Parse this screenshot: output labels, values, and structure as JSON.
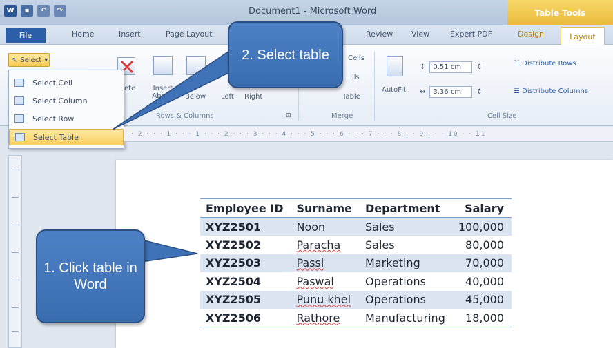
{
  "window": {
    "title": "Document1 - Microsoft Word",
    "contextual_tab_group": "Table Tools"
  },
  "tabs": [
    "File",
    "Home",
    "Insert",
    "Page Layout",
    "Review",
    "View",
    "Expert PDF",
    "Design",
    "Layout"
  ],
  "ribbon": {
    "select_label": "Select",
    "delete_label": "ete",
    "insert_above": "Insert Above",
    "insert_below": "Below",
    "insert_left": "Left",
    "insert_right": "Right",
    "rows_columns_group": "Rows & Columns",
    "merge_cells_top": "Cells",
    "merge_split_cells": "lls",
    "merge_split_table": "Table",
    "merge_group": "Merge",
    "autofit_label": "AutoFit",
    "row_height": "0.51 cm",
    "col_width": "3.36 cm",
    "distribute_rows": "Distribute Rows",
    "distribute_columns": "Distribute Columns",
    "cell_size_group": "Cell Size"
  },
  "select_menu": {
    "items": [
      "Select Cell",
      "Select Column",
      "Select Row",
      "Select Table"
    ],
    "active_index": 3
  },
  "ruler_text": "· 2 · · · 1 · · · 1 · · · 2 · · · 3 · · · 4 · · · 5 · · · 6 · · · 7 · · · 8 · · 9 · · · 10 · · 11",
  "table": {
    "headers": [
      "Employee ID",
      "Surname",
      "Department",
      "Salary"
    ],
    "rows": [
      [
        "XYZ2501",
        "Noon",
        "Sales",
        "100,000"
      ],
      [
        "XYZ2502",
        "Paracha",
        "Sales",
        "80,000"
      ],
      [
        "XYZ2503",
        "Passi",
        "Marketing",
        "70,000"
      ],
      [
        "XYZ2504",
        "Paswal",
        "Operations",
        "40,000"
      ],
      [
        "XYZ2505",
        "Punu khel",
        "Operations",
        "45,000"
      ],
      [
        "XYZ2506",
        "Rathore",
        "Manufacturing",
        "18,000"
      ]
    ]
  },
  "callouts": {
    "step1": "1. Click table in Word",
    "step2": "2. Select table"
  },
  "colors": {
    "callout_fill": "#4d80c4",
    "shaded_row": "#dbe4f1",
    "active_menu": "#f8cf5f"
  }
}
